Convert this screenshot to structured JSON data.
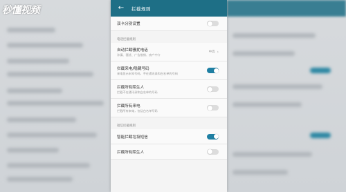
{
  "watermark": "秒懂视频",
  "header": {
    "title": "拦截规则"
  },
  "settings": {
    "dual_card": {
      "label": "双卡分别设置",
      "on": false
    },
    "section_call": "电话拦截规则",
    "auto_block": {
      "label": "自动拦截骚扰电话",
      "sub": "诈骗、骚扰、广告推销、房产中介",
      "value": "中高"
    },
    "block_unknown": {
      "label": "拦截来电/隐藏号码",
      "sub": "来电显示未知号码，不在通讯录和白名单的号码",
      "on": true
    },
    "block_strangers": {
      "label": "拦截所有陌生人",
      "sub": "拦截不在通讯录和白名单的号码",
      "on": false
    },
    "block_all": {
      "label": "拦截所有来电",
      "sub": "拦截所有来电，包括白名单号码",
      "on": false
    },
    "section_sms": "短信拦截规则",
    "smart_sms": {
      "label": "智能拦截垃圾短信",
      "on": true
    },
    "block_sms_strangers": {
      "label": "拦截所有陌生人",
      "on": false
    }
  },
  "colors": {
    "header": "#1e6f86",
    "toggle_on": "#1e7fa3",
    "toggle_off": "#dcdcdc"
  }
}
